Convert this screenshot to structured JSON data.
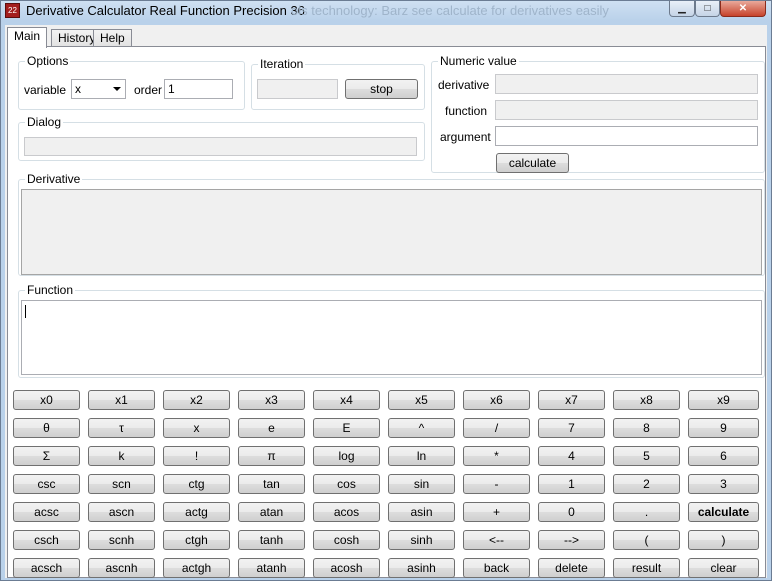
{
  "window": {
    "title": "Derivative Calculator Real Function Precision 36",
    "title_ghost": "ols technology: Barz see calculate for derivatives easily",
    "icon_text": "22",
    "minimize_glyph": "▁",
    "maximize_glyph": "□",
    "close_glyph": "✕"
  },
  "tabs": [
    "Main",
    "History",
    "Help"
  ],
  "options": {
    "legend": "Options",
    "variable_label": "variable",
    "variable_value": "x",
    "order_label": "order",
    "order_value": "1"
  },
  "iteration": {
    "legend": "Iteration",
    "value": "",
    "stop_label": "stop"
  },
  "numeric": {
    "legend": "Numeric value",
    "derivative_label": "derivative",
    "derivative_value": "",
    "function_label": "function",
    "function_value": "",
    "argument_label": "argument",
    "argument_value": "",
    "calculate_label": "calculate"
  },
  "dialog": {
    "legend": "Dialog",
    "value": ""
  },
  "derivative": {
    "legend": "Derivative",
    "value": ""
  },
  "function": {
    "legend": "Function",
    "value": ""
  },
  "keypad": [
    [
      "x0",
      "x1",
      "x2",
      "x3",
      "x4",
      "x5",
      "x6",
      "x7",
      "x8",
      "x9"
    ],
    [
      "θ",
      "τ",
      "x",
      "e",
      "E",
      "^",
      "/",
      "7",
      "8",
      "9"
    ],
    [
      "Σ",
      "k",
      "!",
      "π",
      "log",
      "ln",
      "*",
      "4",
      "5",
      "6"
    ],
    [
      "csc",
      "scn",
      "ctg",
      "tan",
      "cos",
      "sin",
      "-",
      "1",
      "2",
      "3"
    ],
    [
      "acsc",
      "ascn",
      "actg",
      "atan",
      "acos",
      "asin",
      "+",
      "0",
      ".",
      "calculate"
    ],
    [
      "csch",
      "scnh",
      "ctgh",
      "tanh",
      "cosh",
      "sinh",
      "<--",
      "-->",
      "(",
      ")"
    ],
    [
      "acsch",
      "ascnh",
      "actgh",
      "atanh",
      "acosh",
      "asinh",
      "back",
      "delete",
      "result",
      "clear"
    ]
  ]
}
